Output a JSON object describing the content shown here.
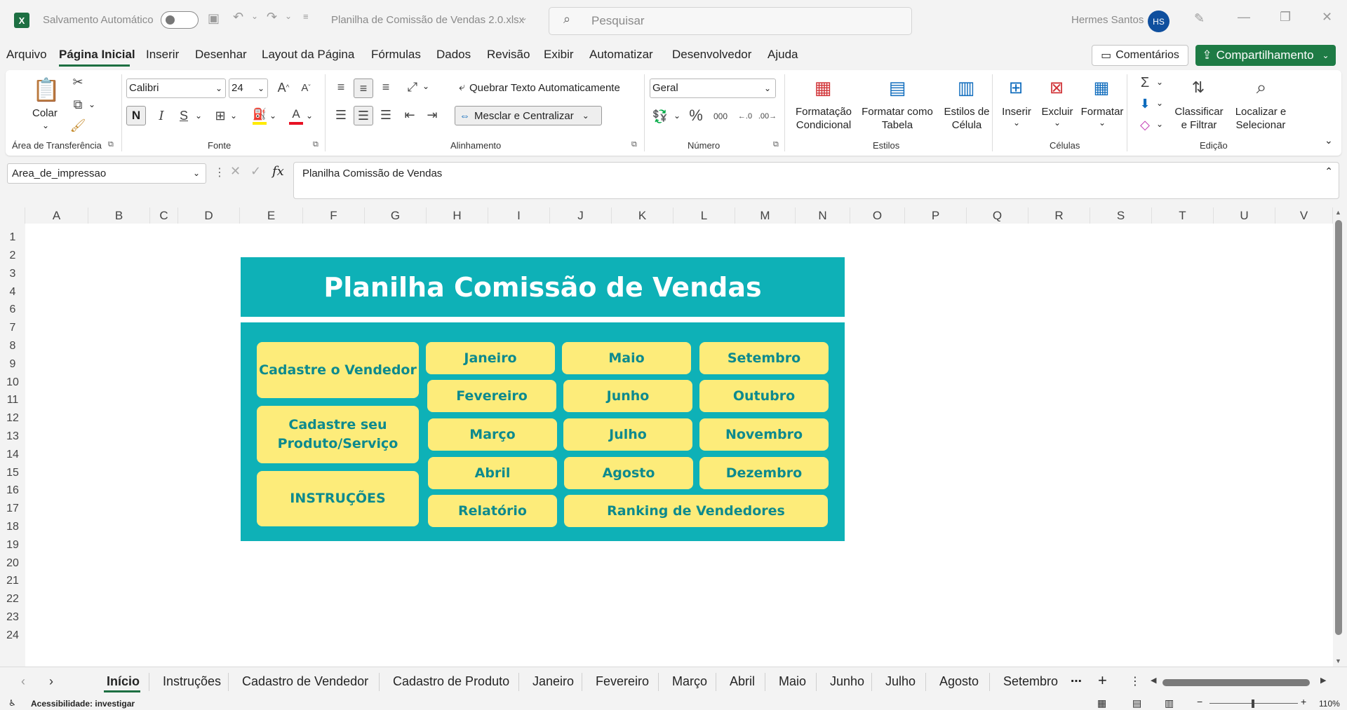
{
  "titlebar": {
    "autosave_label": "Salvamento Automático",
    "filename": "Planilha de Comissão de Vendas 2.0.xlsx",
    "search_placeholder": "Pesquisar",
    "user_name": "Hermes Santos",
    "user_initials": "HS"
  },
  "menu": {
    "items": [
      "Arquivo",
      "Página Inicial",
      "Inserir",
      "Desenhar",
      "Layout da Página",
      "Fórmulas",
      "Dados",
      "Revisão",
      "Exibir",
      "Automatizar",
      "Desenvolvedor",
      "Ajuda"
    ],
    "comments": "Comentários",
    "share": "Compartilhamento"
  },
  "ribbon": {
    "clipboard": {
      "paste": "Colar",
      "group": "Área de Transferência"
    },
    "font": {
      "name": "Calibri",
      "size": "24",
      "bold": "N",
      "italic": "I",
      "underline": "S",
      "group": "Fonte"
    },
    "alignment": {
      "wrap": "Quebrar Texto Automaticamente",
      "merge": "Mesclar e Centralizar",
      "group": "Alinhamento"
    },
    "number": {
      "format": "Geral",
      "percent": "%",
      "thousands": "000",
      "group": "Número"
    },
    "styles": {
      "conditional_1": "Formatação",
      "conditional_2": "Condicional",
      "table_1": "Formatar como",
      "table_2": "Tabela",
      "cell_1": "Estilos de",
      "cell_2": "Célula",
      "group": "Estilos"
    },
    "cells": {
      "insert": "Inserir",
      "delete": "Excluir",
      "format": "Formatar",
      "group": "Células"
    },
    "editing": {
      "sort_1": "Classificar",
      "sort_2": "e Filtrar",
      "find_1": "Localizar e",
      "find_2": "Selecionar",
      "group": "Edição"
    }
  },
  "formula_bar": {
    "name_box": "Area_de_impressao",
    "fx": "fx",
    "value": "Planilha Comissão de Vendas"
  },
  "columns": [
    "A",
    "B",
    "C",
    "D",
    "E",
    "F",
    "G",
    "H",
    "I",
    "J",
    "K",
    "L",
    "M",
    "N",
    "O",
    "P",
    "Q",
    "R",
    "S",
    "T",
    "U",
    "V"
  ],
  "rows": [
    "1",
    "2",
    "3",
    "4",
    "6",
    "7",
    "8",
    "9",
    "10",
    "11",
    "12",
    "13",
    "14",
    "15",
    "16",
    "17",
    "18",
    "19",
    "20",
    "21",
    "22",
    "23",
    "24"
  ],
  "sheet": {
    "title": "Planilha Comissão de Vendas",
    "buttons": {
      "register_seller": "Cadastre o Vendedor",
      "register_product": "Cadastre seu Produto/Serviço",
      "instructions": "INSTRUÇÕES",
      "jan": "Janeiro",
      "feb": "Fevereiro",
      "mar": "Março",
      "apr": "Abril",
      "may": "Maio",
      "jun": "Junho",
      "jul": "Julho",
      "aug": "Agosto",
      "sep": "Setembro",
      "oct": "Outubro",
      "nov": "Novembro",
      "dec": "Dezembro",
      "report": "Relatório",
      "ranking": "Ranking de Vendedores"
    },
    "colors": {
      "teal": "#0eb1b7",
      "yellow": "#fdec7a",
      "text": "#0d8a8e"
    }
  },
  "tabs": [
    "Início",
    "Instruções",
    "Cadastro de Vendedor",
    "Cadastro de Produto",
    "Janeiro",
    "Fevereiro",
    "Março",
    "Abril",
    "Maio",
    "Junho",
    "Julho",
    "Agosto",
    "Setembro"
  ],
  "status": {
    "accessibility": "Acessibilidade: investigar",
    "zoom": "110%"
  }
}
